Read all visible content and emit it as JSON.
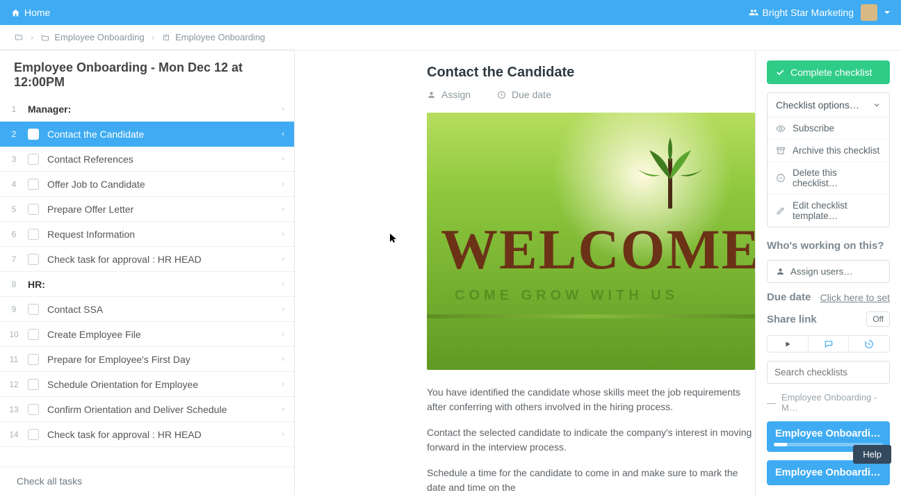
{
  "header": {
    "home_label": "Home",
    "org_label": "Bright Star Marketing"
  },
  "breadcrumbs": {
    "item1": "Employee Onboarding",
    "item2": "Employee Onboarding"
  },
  "left": {
    "title": "Employee Onboarding - Mon Dec 12 at 12:00PM",
    "check_all": "Check all tasks",
    "tasks": [
      {
        "num": "1",
        "label": "Manager:",
        "section": true
      },
      {
        "num": "2",
        "label": "Contact the Candidate",
        "active": true
      },
      {
        "num": "3",
        "label": "Contact References"
      },
      {
        "num": "4",
        "label": "Offer Job to Candidate"
      },
      {
        "num": "5",
        "label": "Prepare Offer Letter"
      },
      {
        "num": "6",
        "label": "Request Information"
      },
      {
        "num": "7",
        "label": "Check task for approval : HR HEAD"
      },
      {
        "num": "8",
        "label": "HR:",
        "section": true
      },
      {
        "num": "9",
        "label": "Contact SSA"
      },
      {
        "num": "10",
        "label": "Create Employee File"
      },
      {
        "num": "11",
        "label": "Prepare for Employee's First Day"
      },
      {
        "num": "12",
        "label": "Schedule Orientation for Employee"
      },
      {
        "num": "13",
        "label": "Confirm Orientation and Deliver Schedule"
      },
      {
        "num": "14",
        "label": "Check task for approval : HR HEAD"
      }
    ]
  },
  "doc": {
    "title": "Contact the Candidate",
    "assign_label": "Assign",
    "due_label": "Due date",
    "hero_title": "WELCOME",
    "hero_tag": "COME GROW WITH US",
    "p1": "You have identified the candidate whose skills meet the job requirements after conferring with others involved in the hiring process.",
    "p2": "Contact the selected candidate to indicate the company's interest in moving forward in the interview process.",
    "p3": "Schedule a time for the candidate to come in and make sure to mark the date and time on the"
  },
  "right": {
    "complete_label": "Complete checklist",
    "options_label": "Checklist options…",
    "opt_subscribe": "Subscribe",
    "opt_archive": "Archive this checklist",
    "opt_delete": "Delete this checklist…",
    "opt_edit": "Edit checklist template…",
    "who_label": "Who's working on this?",
    "assign_users": "Assign users…",
    "due_label": "Due date",
    "due_link": "Click here to set",
    "share_label": "Share link",
    "share_value": "Off",
    "search_placeholder": "Search checklists",
    "mini_label": "Employee Onboarding - M…",
    "card1_title": "Employee Onboarding - …",
    "card2_title": "Employee Onboarding",
    "help_label": "Help"
  }
}
